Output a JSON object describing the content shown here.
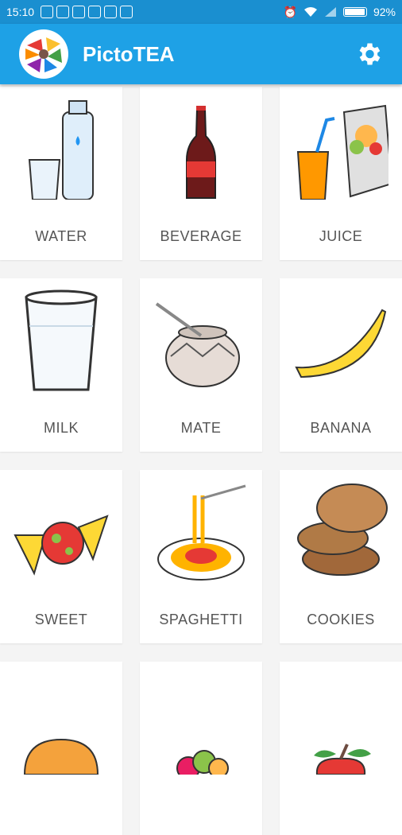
{
  "status_bar": {
    "time": "15:10",
    "battery": "92%"
  },
  "app": {
    "title": "PictoTEA"
  },
  "items": [
    {
      "label": "WATER",
      "icon": "water-icon"
    },
    {
      "label": "BEVERAGE",
      "icon": "beverage-icon"
    },
    {
      "label": "JUICE",
      "icon": "juice-icon"
    },
    {
      "label": "MILK",
      "icon": "milk-icon"
    },
    {
      "label": "MATE",
      "icon": "mate-icon"
    },
    {
      "label": "BANANA",
      "icon": "banana-icon"
    },
    {
      "label": "SWEET",
      "icon": "sweet-icon"
    },
    {
      "label": "SPAGHETTI",
      "icon": "spaghetti-icon"
    },
    {
      "label": "COOKIES",
      "icon": "cookies-icon"
    }
  ]
}
